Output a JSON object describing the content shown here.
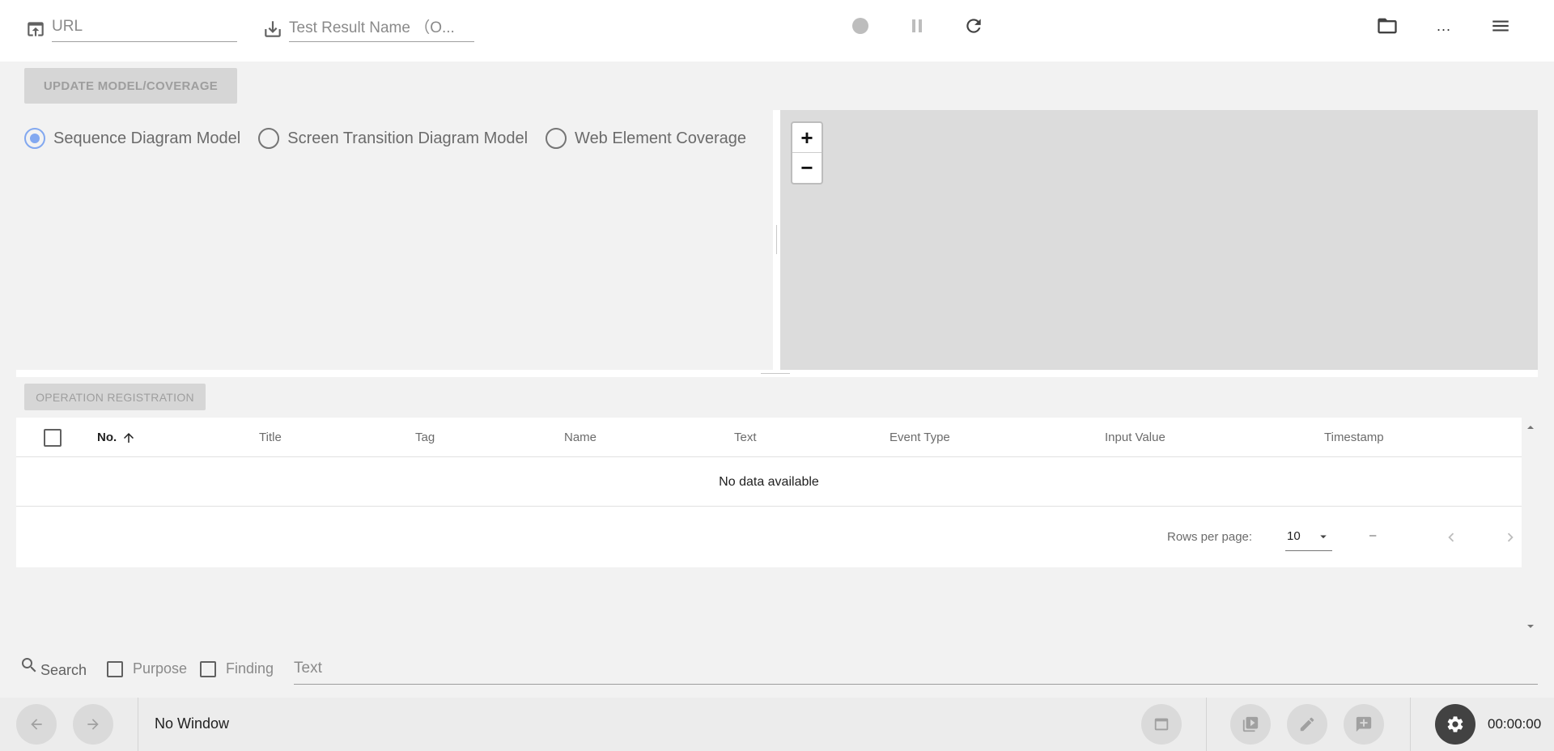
{
  "toolbar": {
    "url_placeholder": "URL",
    "test_result_placeholder": "Test Result Name （O...",
    "icons": [
      "open-in-browser-icon",
      "download-icon",
      "record-icon",
      "pause-icon",
      "refresh-icon",
      "folder-icon",
      "more-icon",
      "menu-icon"
    ],
    "more_label": "..."
  },
  "model": {
    "update_button": "UPDATE MODEL/COVERAGE",
    "options": [
      {
        "label": "Sequence Diagram Model",
        "checked": true
      },
      {
        "label": "Screen Transition Diagram Model",
        "checked": false
      },
      {
        "label": "Web Element Coverage",
        "checked": false
      }
    ]
  },
  "map": {
    "zoom_in": "+",
    "zoom_out": "−"
  },
  "operations": {
    "register_button": "OPERATION REGISTRATION",
    "columns": [
      "No.",
      "Title",
      "Tag",
      "Name",
      "Text",
      "Event Type",
      "Input Value",
      "Timestamp"
    ],
    "sorted_column": "No.",
    "empty_text": "No data available",
    "rows_per_page_label": "Rows per page:",
    "rows_per_page_value": "10",
    "page_range": "–"
  },
  "search": {
    "label": "Search",
    "purpose_label": "Purpose",
    "finding_label": "Finding",
    "text_placeholder": "Text"
  },
  "bottom": {
    "window_status": "No Window",
    "timer": "00:00:00",
    "colors": {
      "accent": "#82a8f0",
      "gear_button": "#424242"
    }
  }
}
